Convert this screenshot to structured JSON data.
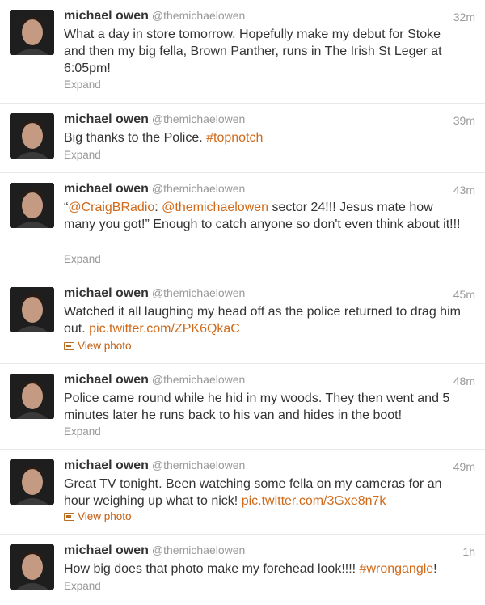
{
  "tweets": [
    {
      "name": "michael owen",
      "handle": "@themichaelowen",
      "time": "32m",
      "text": [
        "What a day in store tomorrow. Hopefully make my debut for Stoke and then my big fella, Brown Panther, runs in The Irish St Leger at 6:05pm!"
      ],
      "footer": "Expand"
    },
    {
      "name": "michael owen",
      "handle": "@themichaelowen",
      "time": "39m",
      "text": [
        "Big thanks to the Police. ",
        "#topnotch"
      ],
      "footer": "Expand"
    },
    {
      "name": "michael owen",
      "handle": "@themichaelowen",
      "time": "43m",
      "text": [
        "“",
        "@CraigBRadio",
        ": ",
        "@themichaelowen",
        " sector 24!!! Jesus mate how many you got!” Enough to catch anyone so don't even think about it!!!"
      ],
      "footer": "Expand"
    },
    {
      "name": "michael owen",
      "handle": "@themichaelowen",
      "time": "45m",
      "text": [
        "Watched it all laughing my head off as the police returned to drag him out. ",
        "pic.twitter.com/ZPK6QkaC"
      ],
      "footer": "View photo"
    },
    {
      "name": "michael owen",
      "handle": "@themichaelowen",
      "time": "48m",
      "text": [
        "Police came round while he hid in my woods. They then went and 5 minutes later he runs back to his van and hides in the boot!"
      ],
      "footer": "Expand"
    },
    {
      "name": "michael owen",
      "handle": "@themichaelowen",
      "time": "49m",
      "text": [
        "Great TV tonight. Been watching some fella on my cameras for an hour weighing up what to nick! ",
        "pic.twitter.com/3Gxe8n7k"
      ],
      "footer": "View photo"
    },
    {
      "name": "michael owen",
      "handle": "@themichaelowen",
      "time": "1h",
      "text": [
        "How big does that photo make my forehead look!!!! ",
        "#wrongangle",
        "!"
      ],
      "footer": "Expand"
    }
  ],
  "colors": {
    "link": "#d06a1a",
    "muted": "#999999",
    "text": "#333333",
    "divider": "#e8e8e8"
  }
}
